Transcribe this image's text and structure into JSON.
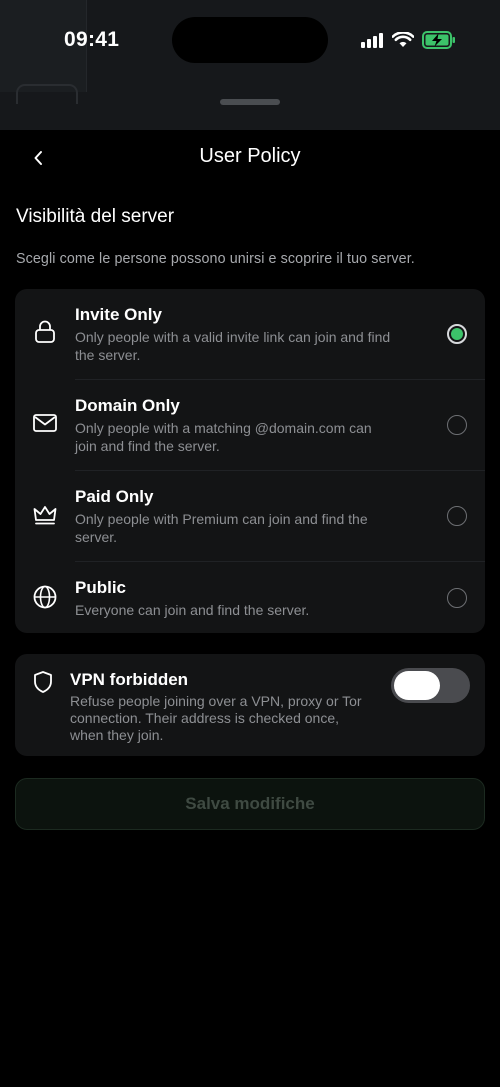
{
  "status_bar": {
    "time": "09:41"
  },
  "nav": {
    "title": "User Policy"
  },
  "visibility": {
    "title": "Visibilità del server",
    "description": "Scegli come le persone possono unirsi e scoprire il tuo server.",
    "options": [
      {
        "icon": "lock-icon",
        "title": "Invite Only",
        "description": "Only people with a valid invite link can join and find the server.",
        "selected": true
      },
      {
        "icon": "mail-icon",
        "title": "Domain Only",
        "description": "Only people with a matching @domain.com can join and find the server.",
        "selected": false
      },
      {
        "icon": "crown-icon",
        "title": "Paid Only",
        "description": "Only people with Premium can join and find the server.",
        "selected": false
      },
      {
        "icon": "globe-icon",
        "title": "Public",
        "description": "Everyone can join and find the server.",
        "selected": false
      }
    ]
  },
  "vpn": {
    "icon": "shield-icon",
    "title": "VPN forbidden",
    "description": "Refuse people joining over a VPN, proxy or Tor connection. Their address is checked once, when they join.",
    "enabled": false
  },
  "save_button": {
    "label": "Salva modifiche",
    "disabled": true
  },
  "colors": {
    "accent_green": "#3cc36a",
    "background": "#000000",
    "card": "#131415"
  }
}
